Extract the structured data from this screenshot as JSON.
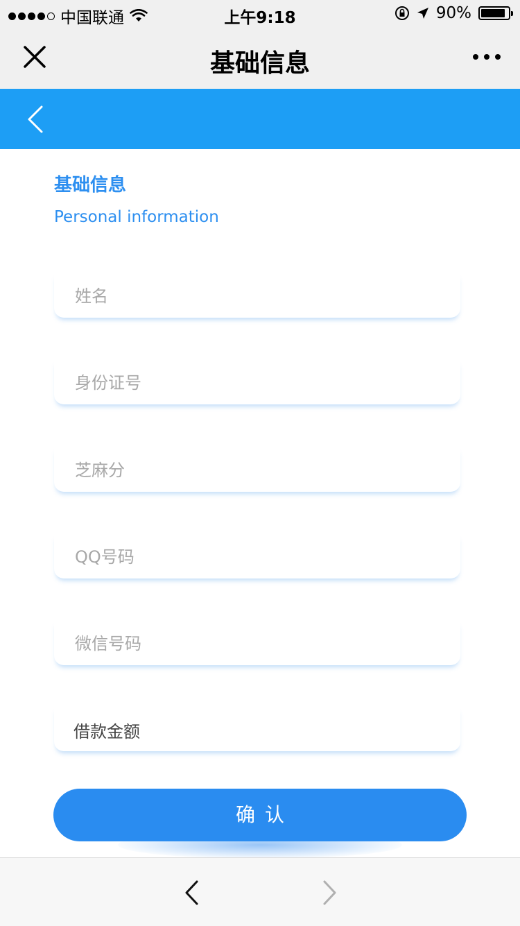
{
  "status_bar": {
    "carrier": "中国联通",
    "time": "上午9:18",
    "battery_percent": "90%",
    "battery_level": 0.9,
    "icons": [
      "signal-icon",
      "wifi-icon",
      "orientation-lock-icon",
      "location-arrow-icon",
      "battery-icon"
    ]
  },
  "title_bar": {
    "title": "基础信息",
    "close_icon": "close-icon",
    "more_icon": "more-dots-icon"
  },
  "header": {
    "back_icon": "chevron-left-icon",
    "color": "#1d9ef5"
  },
  "section": {
    "title_cn": "基础信息",
    "title_en": "Personal information",
    "accent": "#2d8ff0"
  },
  "form": {
    "name_placeholder": "姓名",
    "id_placeholder": "身份证号",
    "sesame_placeholder": "芝麻分",
    "qq_placeholder": "QQ号码",
    "wechat_placeholder": "微信号码",
    "loan_amount_label": "借款金额"
  },
  "confirm": {
    "label": "确认",
    "color": "#2a8cf0"
  },
  "bottom_bar": {
    "back_icon": "chevron-left-icon",
    "forward_icon": "chevron-right-icon"
  }
}
